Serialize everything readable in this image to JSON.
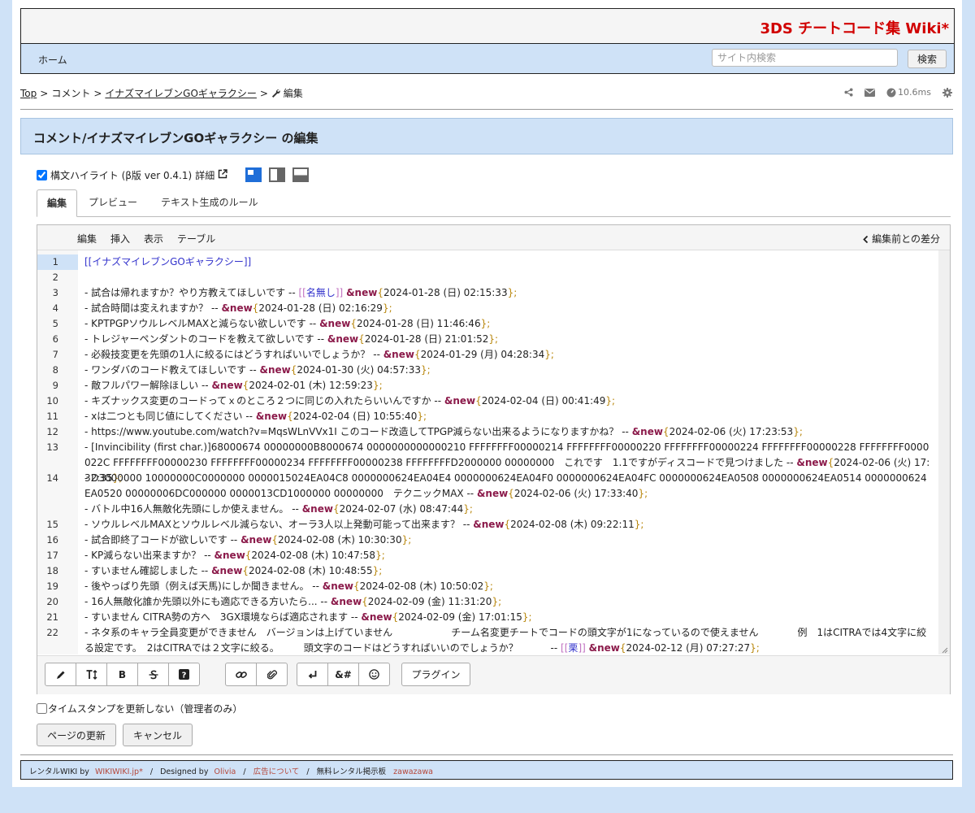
{
  "site": {
    "title": "3DS チートコード集 Wiki*"
  },
  "nav": {
    "home": "ホーム",
    "search_placeholder": "サイト内検索",
    "search_button": "検索"
  },
  "breadcrumb": {
    "top": "Top",
    "sep": ">",
    "comment": "コメント",
    "page": "イナズマイレブンGOギャラクシー",
    "edit": "編集"
  },
  "tools": {
    "timing": "10.6ms",
    "icons": [
      "share-icon",
      "mail-icon",
      "speed-icon",
      "gear-icon"
    ]
  },
  "page_title": "コメント/イナズマイレブンGOギャラクシー の編集",
  "syntax": {
    "label": "構文ハイライト (β版 ver 0.4.1)",
    "details": "詳細",
    "checked": true
  },
  "tabs": [
    {
      "label": "編集",
      "active": true
    },
    {
      "label": "プレビュー",
      "active": false
    },
    {
      "label": "テキスト生成のルール",
      "active": false
    }
  ],
  "editor_menu": {
    "items": [
      "編集",
      "挿入",
      "表示",
      "テーブル"
    ],
    "diff": "編集前との差分"
  },
  "lines": [
    {
      "n": "1",
      "parts": [
        [
          "link",
          "[[イナズマイレブンGOギャラクシー]]"
        ]
      ]
    },
    {
      "n": "2",
      "parts": []
    },
    {
      "n": "3",
      "parts": [
        [
          "t",
          "- 試合は帰れますか？やり方教えてほしいです -- "
        ],
        [
          "br",
          "[["
        ],
        [
          "link",
          "名無し"
        ],
        [
          "br",
          "]]"
        ],
        [
          "t",
          " "
        ],
        [
          "new",
          "&new"
        ],
        [
          "par",
          "{"
        ],
        [
          "t",
          "2024-01-28 (日) 02:15:33"
        ],
        [
          "par",
          "};"
        ]
      ]
    },
    {
      "n": "4",
      "parts": [
        [
          "t",
          "- 試合時間は変えれますか？ --  "
        ],
        [
          "new",
          "&new"
        ],
        [
          "par",
          "{"
        ],
        [
          "t",
          "2024-01-28 (日) 02:16:29"
        ],
        [
          "par",
          "};"
        ]
      ]
    },
    {
      "n": "5",
      "parts": [
        [
          "t",
          "- KPTPGPソウルレベルMAXと減らない欲しいです --  "
        ],
        [
          "new",
          "&new"
        ],
        [
          "par",
          "{"
        ],
        [
          "t",
          "2024-01-28 (日) 11:46:46"
        ],
        [
          "par",
          "};"
        ]
      ]
    },
    {
      "n": "6",
      "parts": [
        [
          "t",
          "- トレジャーペンダントのコードを教えて欲しいです --  "
        ],
        [
          "new",
          "&new"
        ],
        [
          "par",
          "{"
        ],
        [
          "t",
          "2024-01-28 (日) 21:01:52"
        ],
        [
          "par",
          "};"
        ]
      ]
    },
    {
      "n": "7",
      "parts": [
        [
          "t",
          "- 必殺技変更を先頭の1人に絞るにはどうすればいいでしょうか？ --  "
        ],
        [
          "new",
          "&new"
        ],
        [
          "par",
          "{"
        ],
        [
          "t",
          "2024-01-29 (月) 04:28:34"
        ],
        [
          "par",
          "};"
        ]
      ]
    },
    {
      "n": "8",
      "parts": [
        [
          "t",
          "- ワンダバのコード教えてほしいです --  "
        ],
        [
          "new",
          "&new"
        ],
        [
          "par",
          "{"
        ],
        [
          "t",
          "2024-01-30 (火) 04:57:33"
        ],
        [
          "par",
          "};"
        ]
      ]
    },
    {
      "n": "9",
      "parts": [
        [
          "t",
          "- 敵フルパワー解除ほしい --  "
        ],
        [
          "new",
          "&new"
        ],
        [
          "par",
          "{"
        ],
        [
          "t",
          "2024-02-01 (木) 12:59:23"
        ],
        [
          "par",
          "};"
        ]
      ]
    },
    {
      "n": "10",
      "parts": [
        [
          "t",
          "- キズナックス変更のコードってｘのところ２つに同じの入れたらいいんですか --  "
        ],
        [
          "new",
          "&new"
        ],
        [
          "par",
          "{"
        ],
        [
          "t",
          "2024-02-04 (日) 00:41:49"
        ],
        [
          "par",
          "};"
        ]
      ]
    },
    {
      "n": "11",
      "parts": [
        [
          "t",
          "- xは二つとも同じ値にしてください --  "
        ],
        [
          "new",
          "&new"
        ],
        [
          "par",
          "{"
        ],
        [
          "t",
          "2024-02-04 (日) 10:55:40"
        ],
        [
          "par",
          "};"
        ]
      ]
    },
    {
      "n": "12",
      "parts": [
        [
          "t",
          "- https://www.youtube.com/watch?v=MqsWLnVVx1I このコード改造してTPGP減らない出来るようになりますかね？ --  "
        ],
        [
          "new",
          "&new"
        ],
        [
          "par",
          "{"
        ],
        [
          "t",
          "2024-02-06 (火) 17:23:53"
        ],
        [
          "par",
          "};"
        ]
      ]
    },
    {
      "n": "13",
      "parts": [
        [
          "t",
          "- [Invincibility (first char.)]68000674 00000000B8000674 0000000000000210 FFFFFFFF00000214 FFFFFFFF00000220 FFFFFFFF00000224 FFFFFFFF00000228 FFFFFFFF0000022C FFFFFFFF00000230 FFFFFFFF00000234 FFFFFFFF00000238 FFFFFFFFD2000000 00000000　これです　1.1ですがディスコードで見つけました --  "
        ],
        [
          "new",
          "&new"
        ],
        [
          "par",
          "{"
        ],
        [
          "t",
          "2024-02-06 (火) 17:32:35"
        ],
        [
          "par",
          "};"
        ]
      ]
    },
    {
      "n": "14",
      "parts": [
        [
          "t",
          "- D3000000 10000000C0000000 0000015024EA04C8 0000000624EA04E4 0000000624EA04F0 0000000624EA04FC 0000000624EA0508 0000000624EA0514 0000000624EA0520 00000006DC000000 0000013CD1000000 00000000　テクニックMAX --  "
        ],
        [
          "new",
          "&new"
        ],
        [
          "par",
          "{"
        ],
        [
          "t",
          "2024-02-06 (火) 17:33:40"
        ],
        [
          "par",
          "};"
        ]
      ]
    },
    {
      "n": "",
      "parts": [
        [
          "t",
          "- バトル中16人無敵化先頭にしか使えません。 --  "
        ],
        [
          "new",
          "&new"
        ],
        [
          "par",
          "{"
        ],
        [
          "t",
          "2024-02-07 (水) 08:47:44"
        ],
        [
          "par",
          "};"
        ]
      ]
    },
    {
      "n": "15",
      "parts": [
        [
          "t",
          "- ソウルレベルMAXとソウルレベル減らない、オーラ3人以上発動可能って出来ます？ --  "
        ],
        [
          "new",
          "&new"
        ],
        [
          "par",
          "{"
        ],
        [
          "t",
          "2024-02-08 (木) 09:22:11"
        ],
        [
          "par",
          "};"
        ]
      ]
    },
    {
      "n": "16",
      "parts": [
        [
          "t",
          "- 試合即終了コードが欲しいです --  "
        ],
        [
          "new",
          "&new"
        ],
        [
          "par",
          "{"
        ],
        [
          "t",
          "2024-02-08 (木) 10:30:30"
        ],
        [
          "par",
          "};"
        ]
      ]
    },
    {
      "n": "17",
      "parts": [
        [
          "t",
          "- KP減らない出来ますか？ --  "
        ],
        [
          "new",
          "&new"
        ],
        [
          "par",
          "{"
        ],
        [
          "t",
          "2024-02-08 (木) 10:47:58"
        ],
        [
          "par",
          "};"
        ]
      ]
    },
    {
      "n": "18",
      "parts": [
        [
          "t",
          "- すいません確認しました --  "
        ],
        [
          "new",
          "&new"
        ],
        [
          "par",
          "{"
        ],
        [
          "t",
          "2024-02-08 (木) 10:48:55"
        ],
        [
          "par",
          "};"
        ]
      ]
    },
    {
      "n": "19",
      "parts": [
        [
          "t",
          "- 後やっぱり先頭（例えば天馬)にしか聞きません。 --  "
        ],
        [
          "new",
          "&new"
        ],
        [
          "par",
          "{"
        ],
        [
          "t",
          "2024-02-08 (木) 10:50:02"
        ],
        [
          "par",
          "};"
        ]
      ]
    },
    {
      "n": "20",
      "parts": [
        [
          "t",
          "- 16人無敵化誰か先頭以外にも適応できる方いたら... --  "
        ],
        [
          "new",
          "&new"
        ],
        [
          "par",
          "{"
        ],
        [
          "t",
          "2024-02-09 (金) 11:31:20"
        ],
        [
          "par",
          "};"
        ]
      ]
    },
    {
      "n": "21",
      "parts": [
        [
          "t",
          "- すいません CITRA勢の方へ　3GX環境ならば適応されます --  "
        ],
        [
          "new",
          "&new"
        ],
        [
          "par",
          "{"
        ],
        [
          "t",
          "2024-02-09 (金) 17:01:15"
        ],
        [
          "par",
          "};"
        ]
      ]
    },
    {
      "n": "22",
      "parts": [
        [
          "t",
          "- ネタ系のキャラ全員変更ができません　バージョンは上げていません　　　　　　チーム名変更チートでコードの頭文字が1になっているので使えません　　　　例　1はCITRAでは4文字に絞る設定です。　2はCITRAでは２文字に絞る。　　　頭文字のコードはどうすればいいのでしょうか？　　　 -- "
        ],
        [
          "br",
          "[["
        ],
        [
          "link",
          "栗"
        ],
        [
          "br",
          "]]"
        ],
        [
          "t",
          " "
        ],
        [
          "new",
          "&new"
        ],
        [
          "par",
          "{"
        ],
        [
          "t",
          "2024-02-12 (月) 07:27:27"
        ],
        [
          "par",
          "};"
        ]
      ]
    }
  ],
  "toolbar": {
    "groups": [
      [
        "pencil-icon",
        "text-size-icon",
        "bold-icon",
        "strike-icon",
        "help-icon"
      ],
      [
        "link-icon",
        "attach-icon"
      ],
      [
        "enter-icon",
        "entity-icon",
        "smile-icon"
      ]
    ],
    "bold": "B",
    "entity": "&#",
    "plugin": "プラグイン"
  },
  "timestamp_label": "タイムスタンプを更新しない（管理者のみ）",
  "buttons": {
    "update": "ページの更新",
    "cancel": "キャンセル"
  },
  "footer": {
    "rental": "レンタルWIKI by",
    "wikiwiki": "WIKIWIKI.jp*",
    "designed": "Designed by",
    "olivia": "Olivia",
    "ad": "広告について",
    "bbs": "無料レンタル掲示板",
    "zawazawa": "zawazawa",
    "slash": "/"
  }
}
